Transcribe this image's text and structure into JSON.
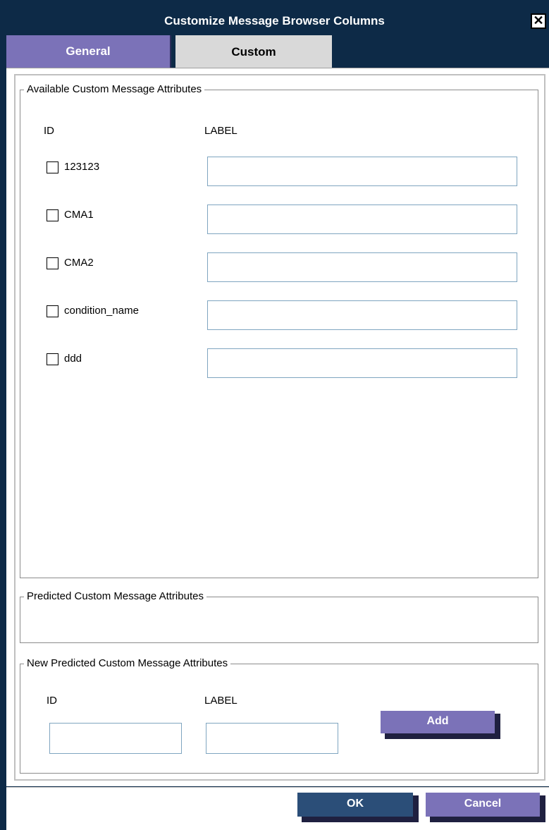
{
  "dialog": {
    "title": "Customize Message Browser Columns",
    "close_glyph": "✕"
  },
  "tabs": [
    {
      "label": "General",
      "active": false
    },
    {
      "label": "Custom",
      "active": true
    }
  ],
  "available": {
    "legend": "Available Custom Message Attributes",
    "id_header": "ID",
    "label_header": "LABEL",
    "rows": [
      {
        "id": "123123",
        "checked": false,
        "label_value": ""
      },
      {
        "id": "CMA1",
        "checked": false,
        "label_value": ""
      },
      {
        "id": "CMA2",
        "checked": false,
        "label_value": ""
      },
      {
        "id": "condition_name",
        "checked": false,
        "label_value": ""
      },
      {
        "id": "ddd",
        "checked": false,
        "label_value": ""
      }
    ]
  },
  "predicted": {
    "legend": "Predicted Custom Message Attributes"
  },
  "new_predicted": {
    "legend": "New Predicted Custom Message Attributes",
    "id_header": "ID",
    "label_header": "LABEL",
    "id_value": "",
    "label_value": "",
    "add_label": "Add"
  },
  "footer": {
    "ok_label": "OK",
    "cancel_label": "Cancel"
  },
  "colors": {
    "title_bar": "#0d2a47",
    "tab_general": "#7b72b8",
    "tab_custom": "#d9d9d9",
    "button_purple": "#7b72b8",
    "button_navy": "#2b4e78",
    "input_border": "#7fa5c0"
  }
}
